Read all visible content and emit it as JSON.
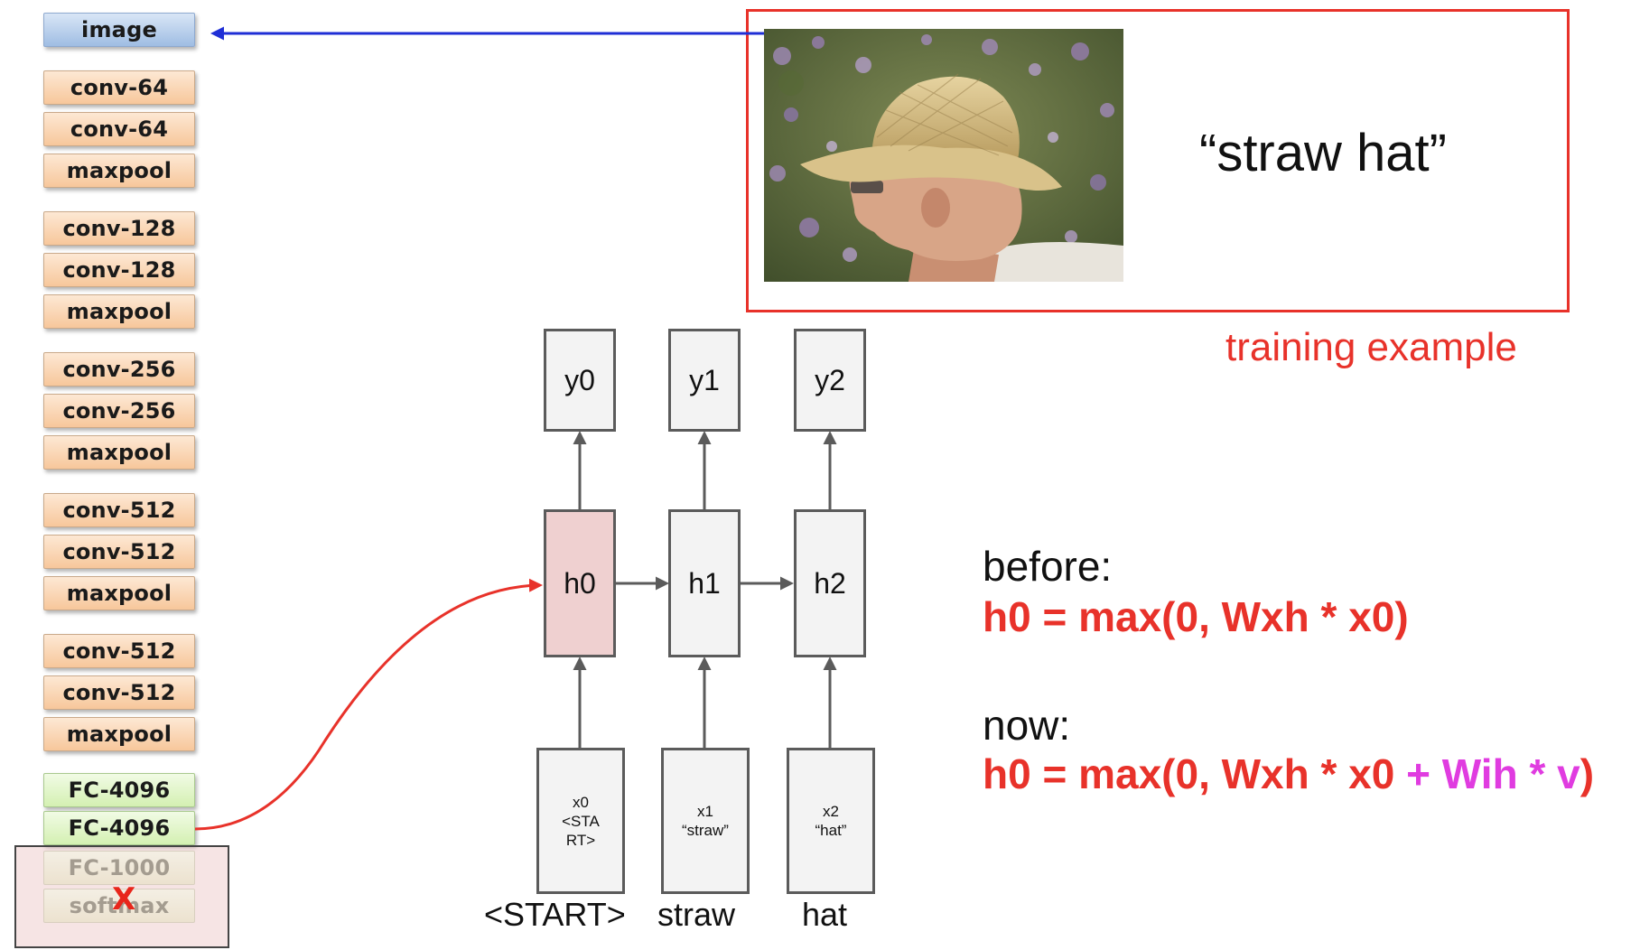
{
  "cnn": {
    "layers": [
      {
        "label": "image",
        "kind": "image"
      },
      {
        "label": "conv-64",
        "kind": "conv"
      },
      {
        "label": "conv-64",
        "kind": "conv"
      },
      {
        "label": "maxpool",
        "kind": "conv"
      },
      {
        "label": "conv-128",
        "kind": "conv"
      },
      {
        "label": "conv-128",
        "kind": "conv"
      },
      {
        "label": "maxpool",
        "kind": "conv"
      },
      {
        "label": "conv-256",
        "kind": "conv"
      },
      {
        "label": "conv-256",
        "kind": "conv"
      },
      {
        "label": "maxpool",
        "kind": "conv"
      },
      {
        "label": "conv-512",
        "kind": "conv"
      },
      {
        "label": "conv-512",
        "kind": "conv"
      },
      {
        "label": "maxpool",
        "kind": "conv"
      },
      {
        "label": "conv-512",
        "kind": "conv"
      },
      {
        "label": "conv-512",
        "kind": "conv"
      },
      {
        "label": "maxpool",
        "kind": "conv"
      },
      {
        "label": "FC-4096",
        "kind": "fc"
      },
      {
        "label": "FC-4096",
        "kind": "fc"
      },
      {
        "label": "FC-1000",
        "kind": "removed"
      },
      {
        "label": "softmax",
        "kind": "removed"
      }
    ],
    "removed_mark": "X"
  },
  "example": {
    "caption": "“straw hat”",
    "label": "training example"
  },
  "rnn": {
    "outputs": [
      "y0",
      "y1",
      "y2"
    ],
    "hidden": [
      "h0",
      "h1",
      "h2"
    ],
    "inputs": [
      {
        "line1": "x0",
        "line2": "<STA",
        "line3": "RT>"
      },
      {
        "line1": "x1",
        "line2": "“straw”",
        "line3": ""
      },
      {
        "line1": "x2",
        "line2": "“hat”",
        "line3": ""
      }
    ],
    "words": [
      "<START>",
      "straw",
      "hat"
    ]
  },
  "formulas": {
    "before_label": "before:",
    "before_formula": "h0 = max(0, Wxh * x0)",
    "now_label": "now:",
    "now_formula_part1": "h0 = max(0, Wxh * x0",
    "now_formula_part2": " + Wih * v",
    "now_formula_part3": ")"
  },
  "colors": {
    "accent_red": "#e8322a",
    "magenta": "#e03ce0",
    "arrow_blue": "#1f2fd6",
    "hidden_highlight": "#efd0d0"
  }
}
